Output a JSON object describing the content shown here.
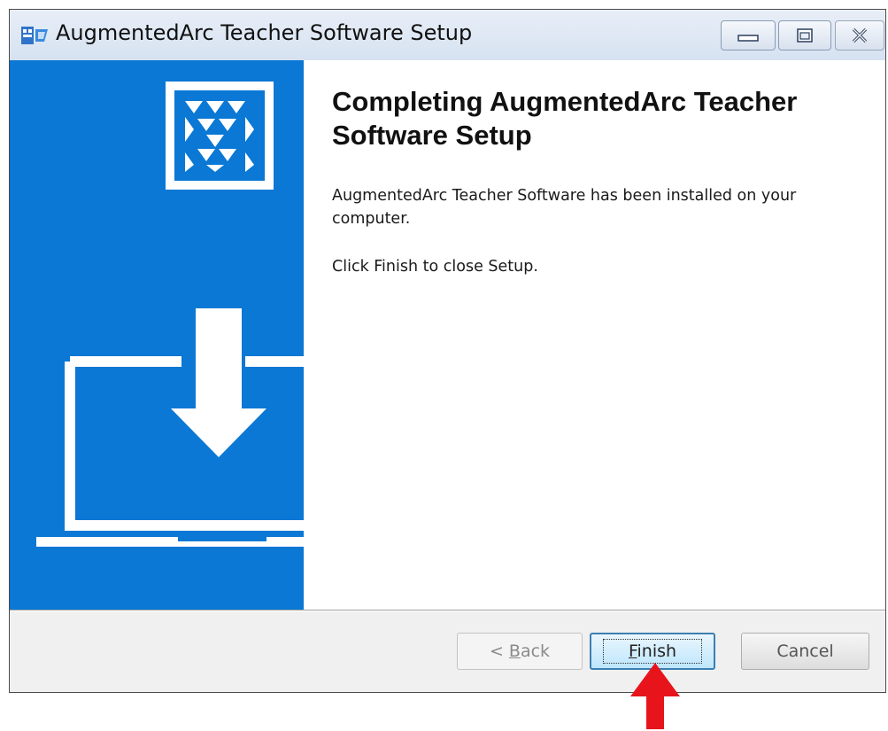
{
  "window": {
    "title": "AugmentedArc Teacher Software Setup",
    "controls": [
      "minimize-icon",
      "maximize-icon",
      "close-icon"
    ]
  },
  "content": {
    "heading": "Completing AugmentedArc Teacher Software Setup",
    "paragraph1": "AugmentedArc Teacher Software has been installed on your computer.",
    "paragraph2": "Click Finish to close Setup."
  },
  "buttons": {
    "back_prefix": "< ",
    "back_accel": "B",
    "back_rest": "ack",
    "finish_accel": "F",
    "finish_rest": "inish",
    "cancel": "Cancel"
  },
  "colors": {
    "banner": "#0a78d4",
    "annotation_arrow": "#e8141c"
  },
  "annotation": {
    "icon": "red-arrow-up-icon"
  }
}
